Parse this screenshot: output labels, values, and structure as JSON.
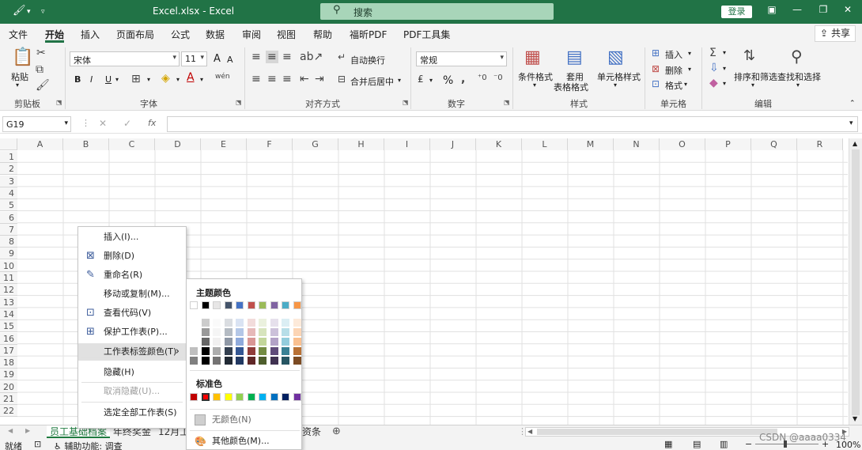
{
  "titlebar": {
    "title": "Excel.xlsx  -  Excel",
    "search_placeholder": "搜索",
    "login": "登录",
    "qa_icons": [
      "brush-icon",
      "undo-arrow",
      "customize"
    ],
    "window_btns": [
      "ribbon-display",
      "minimize",
      "maximize",
      "close"
    ]
  },
  "menus": [
    "文件",
    "开始",
    "插入",
    "页面布局",
    "公式",
    "数据",
    "审阅",
    "视图",
    "帮助",
    "福昕PDF",
    "PDF工具集"
  ],
  "active_menu": "开始",
  "share": "共享",
  "ribbon": {
    "clipboard": {
      "label": "剪贴板",
      "paste": "粘贴"
    },
    "font": {
      "label": "字体",
      "font_name": "宋体",
      "font_size": "11",
      "bold": "B",
      "italic": "I",
      "underline": "U",
      "grow": "A",
      "shrink": "A"
    },
    "alignment": {
      "label": "对齐方式",
      "wrap": "自动换行",
      "merge": "合并后居中"
    },
    "number": {
      "label": "数字",
      "format": "常规",
      "percent": "%"
    },
    "styles": {
      "label": "样式",
      "cond": "条件格式",
      "table1": "套用",
      "table2": "表格格式",
      "cell": "单元格样式"
    },
    "cells": {
      "label": "单元格",
      "insert": "插入",
      "delete": "删除",
      "format": "格式"
    },
    "editing": {
      "label": "编辑",
      "sort": "排序和筛选",
      "find": "查找和选择"
    }
  },
  "formulabar": {
    "namebox": "G19",
    "fx": "fx"
  },
  "columns": [
    "A",
    "B",
    "C",
    "D",
    "E",
    "F",
    "G",
    "H",
    "I",
    "J",
    "K",
    "L",
    "M",
    "N",
    "O",
    "P",
    "Q",
    "R"
  ],
  "rows": [
    "1",
    "2",
    "3",
    "4",
    "5",
    "6",
    "7",
    "8",
    "9",
    "10",
    "11",
    "12",
    "13",
    "14",
    "15",
    "16",
    "17",
    "18",
    "19",
    "20",
    "21",
    "22"
  ],
  "sheets": [
    "员工基础档案",
    "年终奖金",
    "12月工",
    "资条"
  ],
  "status": {
    "ready": "就绪",
    "accessibility": "辅助功能: 调查",
    "zoom": "100%",
    "watermark": "CSDN @aaaa0334"
  },
  "context_menu": [
    {
      "label": "插入(I)...",
      "icon": ""
    },
    {
      "label": "删除(D)",
      "icon": "delete-sheet-icon"
    },
    {
      "label": "重命名(R)",
      "icon": "rename-icon"
    },
    {
      "label": "移动或复制(M)...",
      "icon": ""
    },
    {
      "label": "查看代码(V)",
      "icon": "view-code-icon"
    },
    {
      "label": "保护工作表(P)...",
      "icon": "protect-sheet-icon"
    },
    {
      "label": "工作表标签颜色(T)",
      "icon": ""
    },
    {
      "label": "隐藏(H)",
      "icon": ""
    },
    {
      "label": "取消隐藏(U)...",
      "icon": ""
    },
    {
      "label": "选定全部工作表(S)",
      "icon": ""
    }
  ],
  "submenu": {
    "theme_title": "主题颜色",
    "standard_title": "标准色",
    "no_color": "无颜色(N)",
    "more_colors": "其他颜色(M)...",
    "theme_colors": [
      "#ffffff",
      "#000000",
      "#e7e6e6",
      "#44546a",
      "#4472c4",
      "#c0504d",
      "#9bbb59",
      "#8064a2",
      "#4bacc6",
      "#f79646"
    ],
    "standard_colors": [
      "#c00000",
      "#ff0000",
      "#ffc000",
      "#ffff00",
      "#92d050",
      "#00b050",
      "#00b0f0",
      "#0070c0",
      "#002060",
      "#7030a0"
    ]
  }
}
